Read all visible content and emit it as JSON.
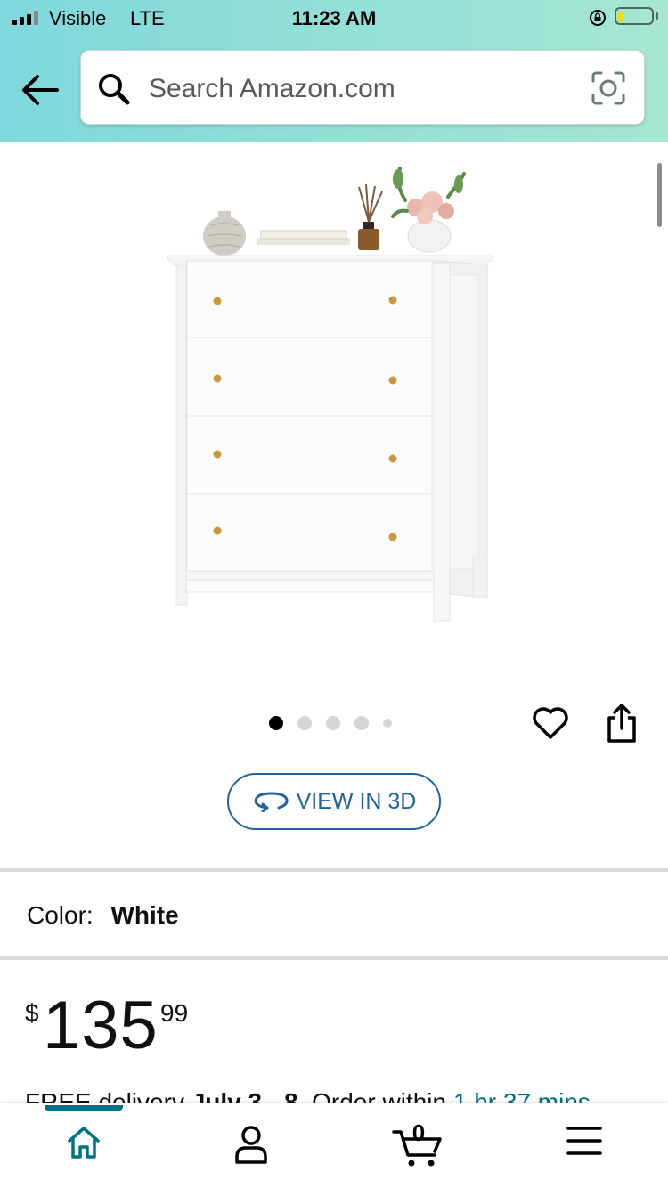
{
  "status_bar": {
    "carrier": "Visible",
    "network": "LTE",
    "time": "11:23 AM"
  },
  "search": {
    "placeholder": "Search Amazon.com"
  },
  "carousel": {
    "total_images": 5,
    "active_index": 0
  },
  "view_3d_label": "VIEW IN 3D",
  "color": {
    "label": "Color:",
    "value": "White"
  },
  "price": {
    "symbol": "$",
    "whole": "135",
    "fraction": "99"
  },
  "delivery": {
    "prefix": "FREE delivery",
    "dates": "July 3 - 8",
    "middle": "Order within",
    "countdown": "1 hr 37 mins"
  },
  "bottom_nav": {
    "cart_count": "0",
    "items": [
      "home",
      "account",
      "cart",
      "menu"
    ],
    "active": "home"
  },
  "colors": {
    "accent_teal": "#007185",
    "link_blue": "#2162a1",
    "header_gradient_start": "#7fd8dd",
    "header_gradient_end": "#a7e6d3"
  }
}
